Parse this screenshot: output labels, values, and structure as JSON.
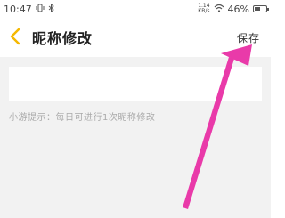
{
  "status_bar": {
    "time": "10:47",
    "speed_top": "1.14",
    "speed_bottom": "KB/s",
    "battery": "46%"
  },
  "header": {
    "title": "昵称修改",
    "save_label": "保存"
  },
  "form": {
    "nickname_value": ""
  },
  "tip": "小游提示：每日可进行1次昵称修改",
  "colors": {
    "accent": "#f5b800",
    "arrow": "#e93aa9"
  },
  "icons": {
    "back": "chevron-left-icon",
    "wifi": "wifi-icon",
    "battery": "battery-icon",
    "bluetooth": "bluetooth-icon",
    "vibrate": "vibrate-icon"
  }
}
